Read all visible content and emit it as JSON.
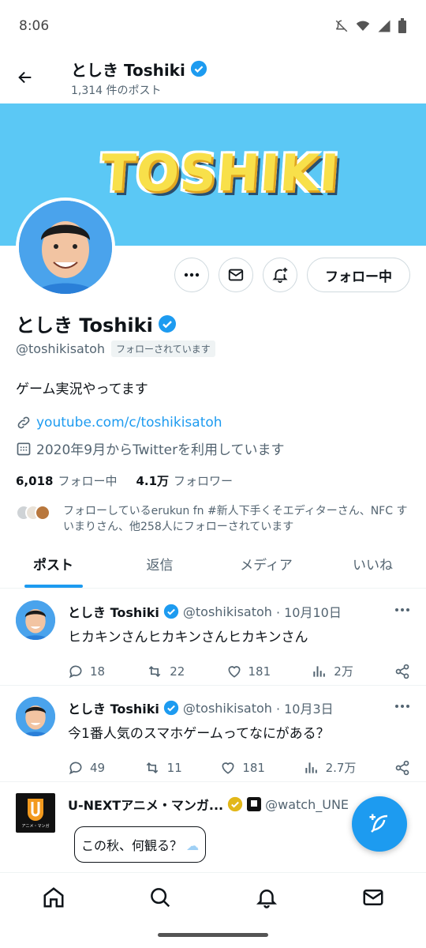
{
  "status_bar": {
    "time": "8:06"
  },
  "header": {
    "name": "としき Toshiki",
    "post_count": "1,314 件のポスト"
  },
  "banner": {
    "text": "TOSHIKI"
  },
  "actions": {
    "follow_label": "フォロー中"
  },
  "profile": {
    "name": "としき Toshiki",
    "handle": "@toshikisatoh",
    "follows_you": "フォローされています",
    "bio": "ゲーム実況やってます",
    "link": "youtube.com/c/toshikisatoh",
    "joined": "2020年9月からTwitterを利用しています",
    "following_count": "6,018",
    "following_label": "フォロー中",
    "followers_count": "4.1万",
    "followers_label": "フォロワー",
    "followed_by": "フォローしているerukun fn #新人下手くそエディターさん、NFC すいまりさん、他258人にフォローされています"
  },
  "tabs": [
    {
      "label": "ポスト"
    },
    {
      "label": "返信"
    },
    {
      "label": "メディア"
    },
    {
      "label": "いいね"
    }
  ],
  "tweets": [
    {
      "name": "としき Toshiki",
      "handle": "@toshikisatoh",
      "date": "· 10月10日",
      "text": "ヒカキンさんヒカキンさんヒカキンさん",
      "replies": "18",
      "retweets": "22",
      "likes": "181",
      "views": "2万"
    },
    {
      "name": "としき Toshiki",
      "handle": "@toshikisatoh",
      "date": "· 10月3日",
      "text": "今1番人気のスマホゲームってなにがある？",
      "replies": "49",
      "retweets": "11",
      "likes": "181",
      "views": "2.7万"
    }
  ],
  "ad": {
    "name": "U-NEXTアニメ・マンガ...",
    "handle": "@watch_UNE",
    "avatar_text": "アニメ・マンガ",
    "speech": "この秋、何観る？"
  },
  "colors": {
    "accent": "#1d9bf0",
    "banner": "#5bc8f5"
  }
}
